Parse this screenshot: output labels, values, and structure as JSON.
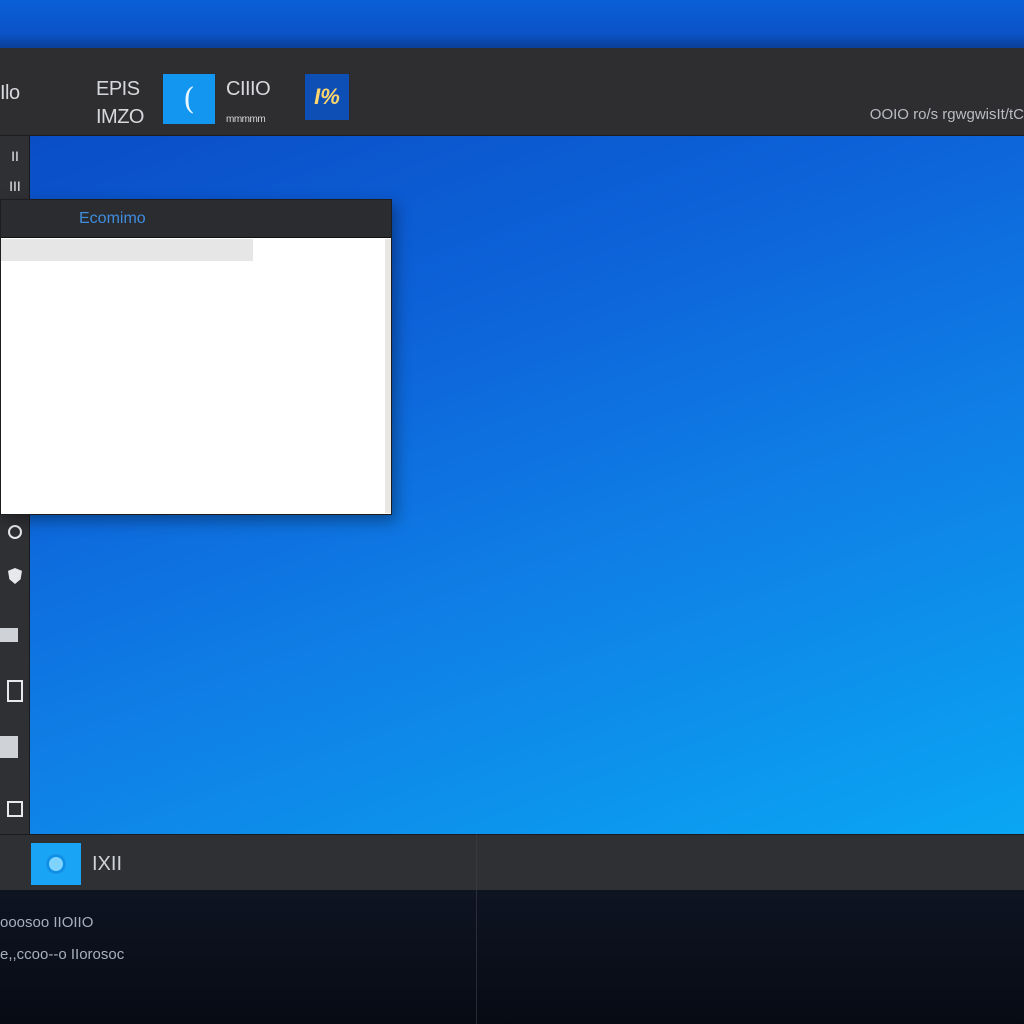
{
  "toolbar": {
    "left_label": "Ilo",
    "group1_top": "EPIS",
    "group1_bottom": "IMZO",
    "tile1_glyph": "(",
    "group2_top": "CIIIO",
    "group2_bottom": "mmmmm",
    "tile2_glyph": "I%",
    "status_text": "OOIO ro/s rgwgwisIt/tC"
  },
  "left_rail": {
    "top_label_1": "II",
    "top_label_2": "III"
  },
  "window": {
    "title": "Ecomimo"
  },
  "taskbar": {
    "start_icon": "start-orb-icon",
    "label": "IXII"
  },
  "bottom": {
    "line1": "ooosoo IIOIIO",
    "line2": "e,,ccoo--o IIorosoc"
  },
  "colors": {
    "desktop_top": "#0a4ec6",
    "desktop_bottom": "#0aa6f3",
    "chrome": "#2e2e30",
    "accent": "#1aa4f5"
  }
}
